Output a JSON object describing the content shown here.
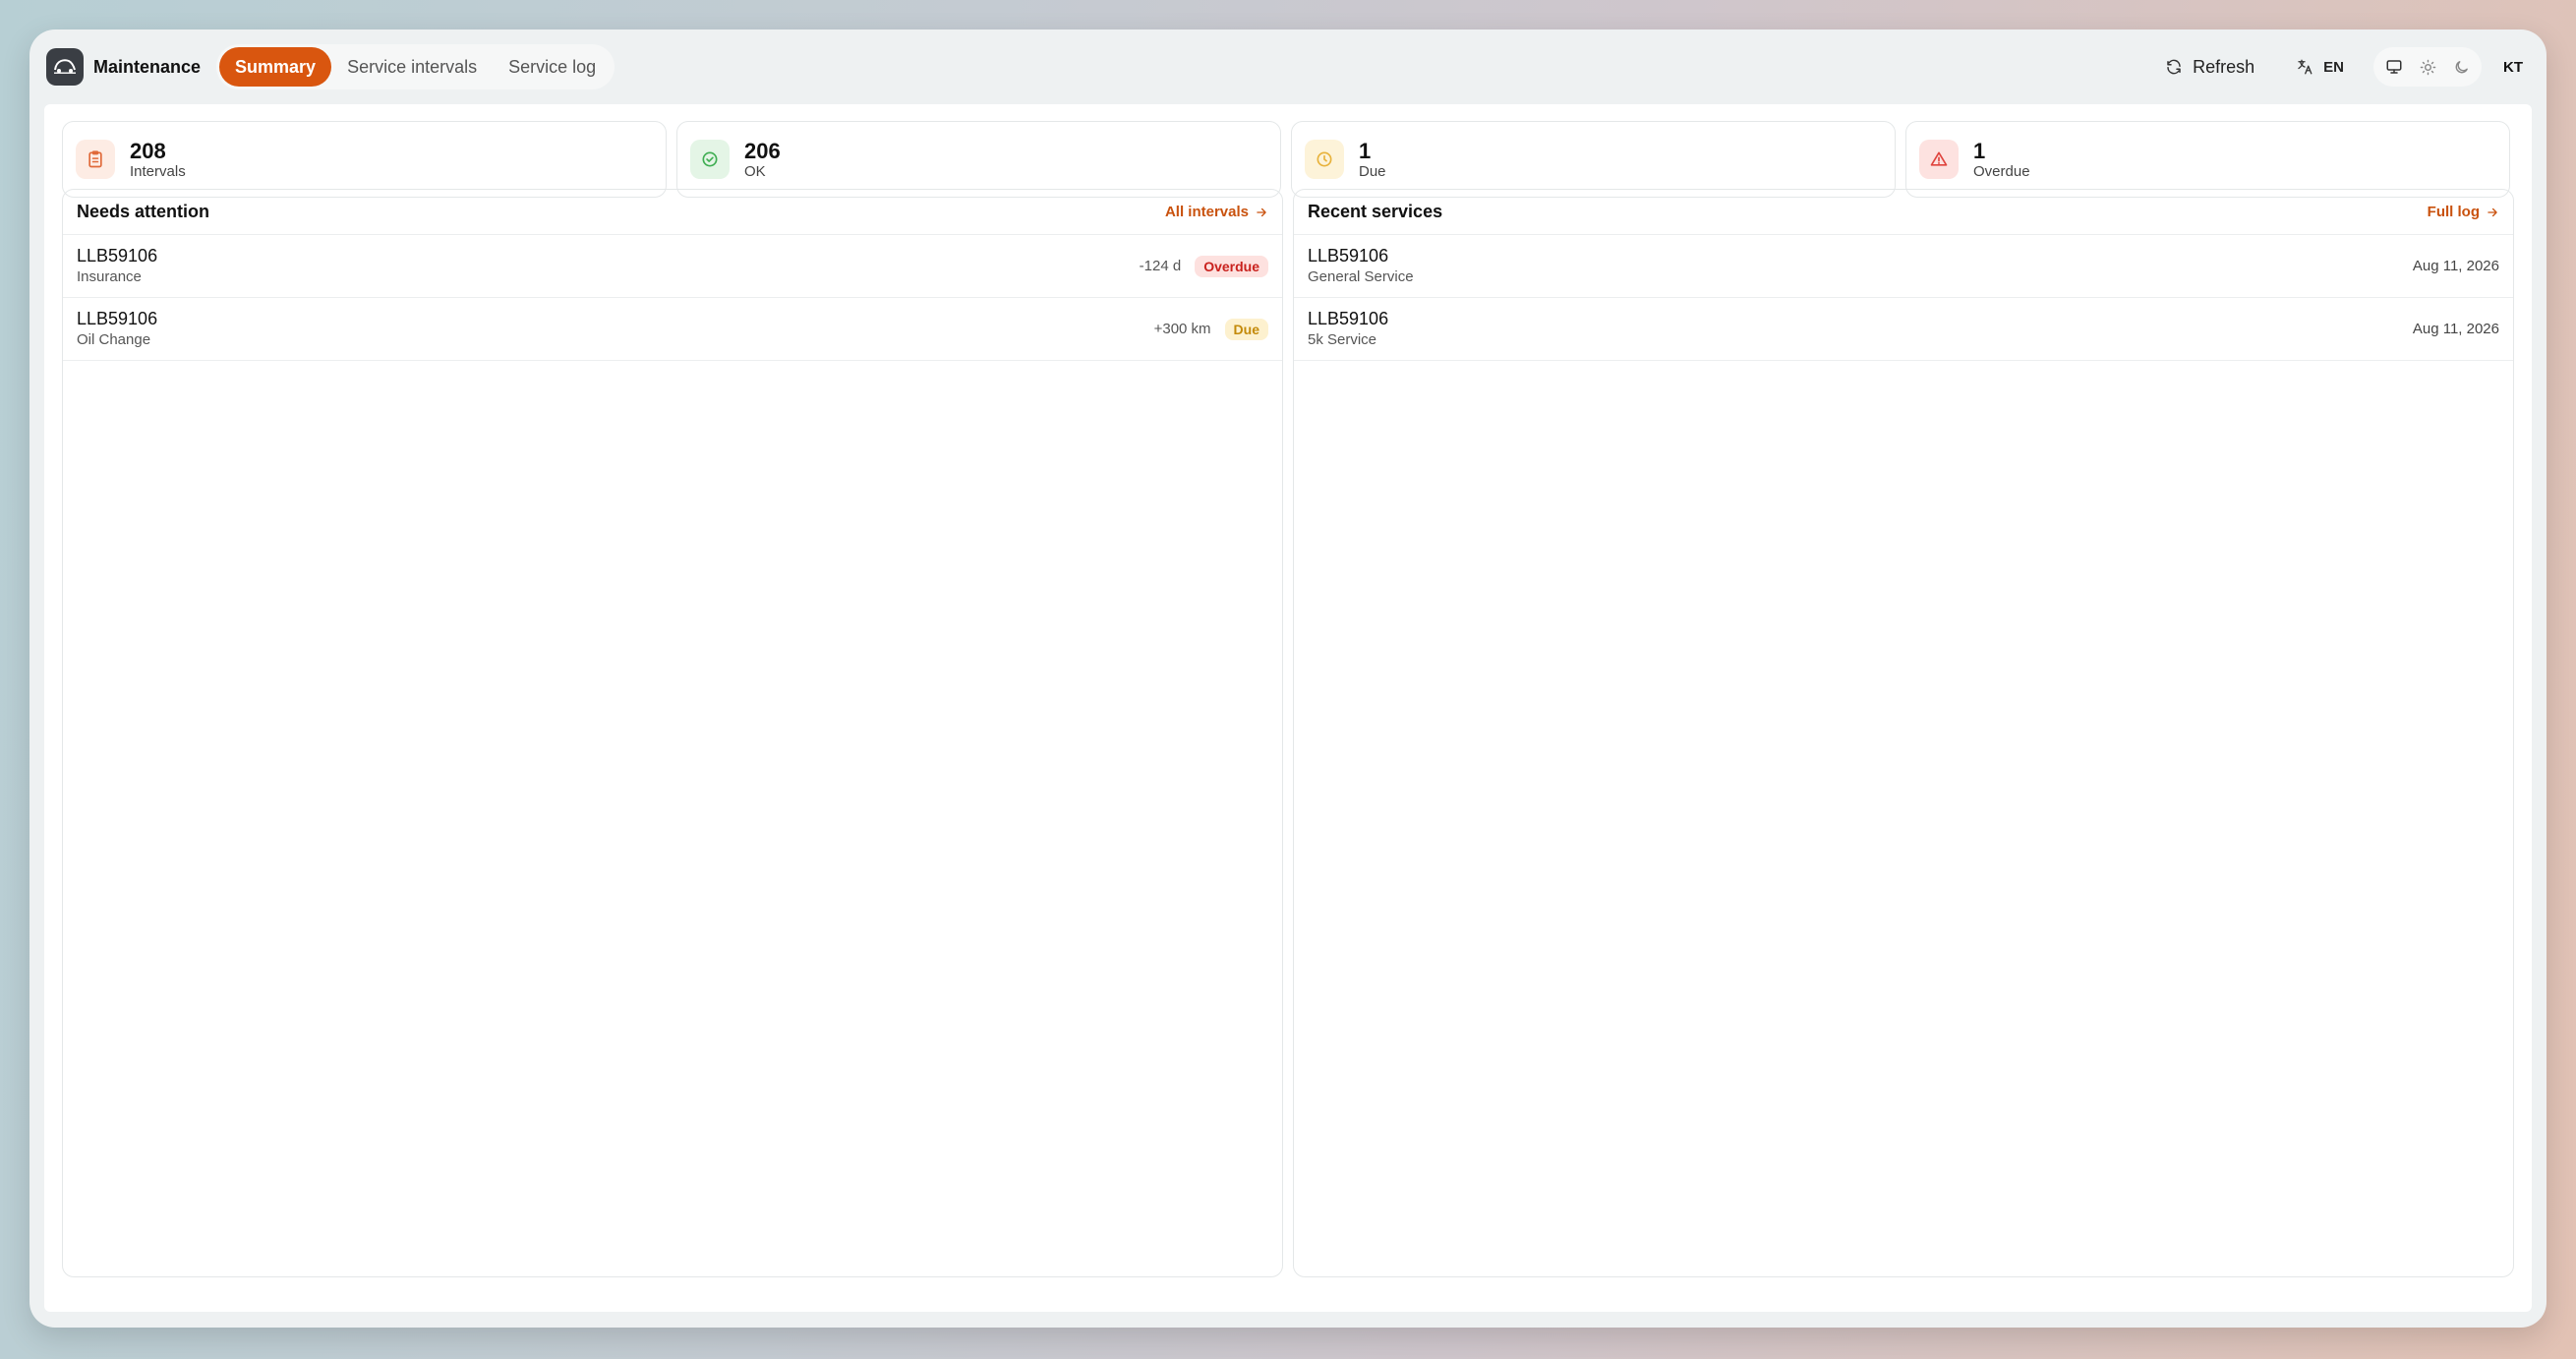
{
  "app": {
    "title": "Maintenance"
  },
  "tabs": [
    {
      "label": "Summary",
      "active": true
    },
    {
      "label": "Service intervals",
      "active": false
    },
    {
      "label": "Service log",
      "active": false
    }
  ],
  "header": {
    "refresh_label": "Refresh",
    "language": "EN",
    "user_initials": "KT",
    "theme_options": [
      "monitor-icon",
      "sun-icon",
      "moon-icon"
    ]
  },
  "stats": [
    {
      "value": "208",
      "label": "Intervals",
      "icon": "clipboard-icon",
      "color": "#e06a3a",
      "bg": "#fdece4"
    },
    {
      "value": "206",
      "label": "OK",
      "icon": "check-circle-icon",
      "color": "#3fae52",
      "bg": "#e4f5e6"
    },
    {
      "value": "1",
      "label": "Due",
      "icon": "clock-icon",
      "color": "#e8b23b",
      "bg": "#fdf3d9"
    },
    {
      "value": "1",
      "label": "Overdue",
      "icon": "warning-triangle-icon",
      "color": "#e0443e",
      "bg": "#fde2e0"
    }
  ],
  "needs_attention": {
    "title": "Needs attention",
    "link_label": "All intervals",
    "rows": [
      {
        "vehicle": "LLB59106",
        "item": "Insurance",
        "delta": "-124 d",
        "status": "Overdue"
      },
      {
        "vehicle": "LLB59106",
        "item": "Oil Change",
        "delta": "+300 km",
        "status": "Due"
      }
    ]
  },
  "recent_services": {
    "title": "Recent services",
    "link_label": "Full log",
    "rows": [
      {
        "vehicle": "LLB59106",
        "service": "General Service",
        "date": "Aug 11, 2026"
      },
      {
        "vehicle": "LLB59106",
        "service": "5k Service",
        "date": "Aug 11, 2026"
      }
    ]
  },
  "colors": {
    "accent": "#d9560f",
    "link": "#c9520e"
  }
}
